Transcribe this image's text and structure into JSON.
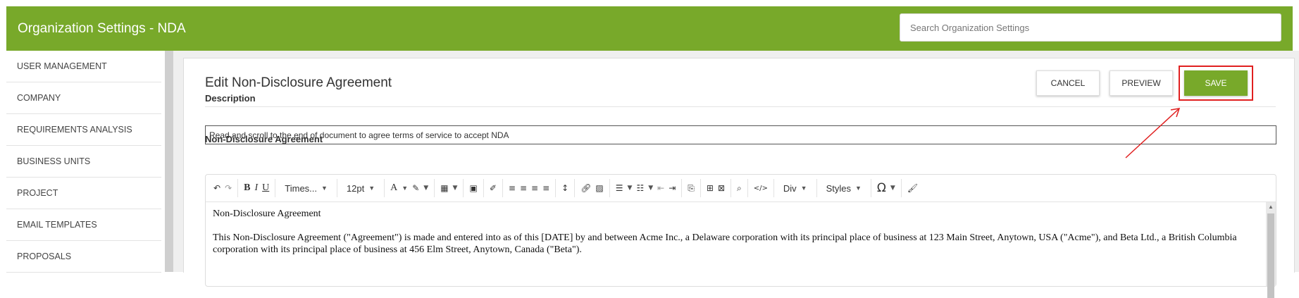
{
  "header": {
    "title": "Organization Settings - NDA",
    "search_placeholder": "Search Organization Settings"
  },
  "sidebar": {
    "items": [
      {
        "label": "USER MANAGEMENT"
      },
      {
        "label": "COMPANY"
      },
      {
        "label": "REQUIREMENTS ANALYSIS"
      },
      {
        "label": "BUSINESS UNITS"
      },
      {
        "label": "PROJECT"
      },
      {
        "label": "EMAIL TEMPLATES"
      },
      {
        "label": "PROPOSALS"
      }
    ]
  },
  "panel": {
    "title": "Edit Non-Disclosure Agreement",
    "buttons": {
      "cancel": "CANCEL",
      "preview": "PREVIEW",
      "save": "SAVE"
    },
    "description_label": "Description",
    "description_value": "Read and scroll to the end of document to agree terms of service to accept NDA",
    "nda_label": "Non-Disclosure Agreement"
  },
  "toolbar": {
    "font_family": "Times...",
    "font_size": "12pt",
    "block_format": "Div",
    "styles": "Styles"
  },
  "document": {
    "heading": "Non-Disclosure Agreement",
    "paragraph1": "This Non-Disclosure Agreement (\"Agreement\") is made and entered into as of this [DATE] by and between Acme Inc., a Delaware corporation with its principal place of business at 123 Main Street, Anytown, USA (\"Acme\"), and Beta Ltd., a British Columbia corporation with its principal place of business at 456 Elm Street, Anytown, Canada (\"Beta\")."
  },
  "colors": {
    "brand": "#78a92a",
    "highlight": "#e02020"
  }
}
